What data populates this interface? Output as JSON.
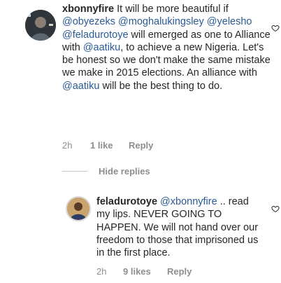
{
  "comments": [
    {
      "username": "xbonnyfire",
      "segments": [
        {
          "t": "It will be more beautiful if ",
          "m": false
        },
        {
          "t": "@obyezeks",
          "m": true
        },
        {
          "t": " ",
          "m": false
        },
        {
          "t": "@moghalukingsley",
          "m": true
        },
        {
          "t": " ",
          "m": false
        },
        {
          "t": "@yelesho",
          "m": true
        },
        {
          "t": " ",
          "m": false
        },
        {
          "t": "@feladurotoye",
          "m": true
        },
        {
          "t": " will emerged as one to Alliance with ",
          "m": false
        },
        {
          "t": "@aatiku",
          "m": true
        },
        {
          "t": ", to achieve a new Nigeria. Let's be honest so we don't make the same mistake we make in 2015 elections. An alliance with ",
          "m": false
        },
        {
          "t": "@aatiku",
          "m": true
        },
        {
          "t": " will be the best thing to do.",
          "m": false
        }
      ],
      "time": "2h",
      "likes": "1 like",
      "reply": "Reply"
    },
    {
      "username": "feladurotoye",
      "segments": [
        {
          "t": "@xbonnyfire",
          "m": true
        },
        {
          "t": " .. read my lips. NEVER GOING TO HAPPEN. We will not hand over our freedom to those that imprisoned us in the first place.",
          "m": false
        }
      ],
      "time": "2h",
      "likes": "9 likes",
      "reply": "Reply"
    }
  ],
  "replies_toggle": "Hide replies",
  "icons": {
    "like": "heart-outline-icon",
    "avatar1": "profile-photo",
    "avatar2": "profile-photo"
  }
}
